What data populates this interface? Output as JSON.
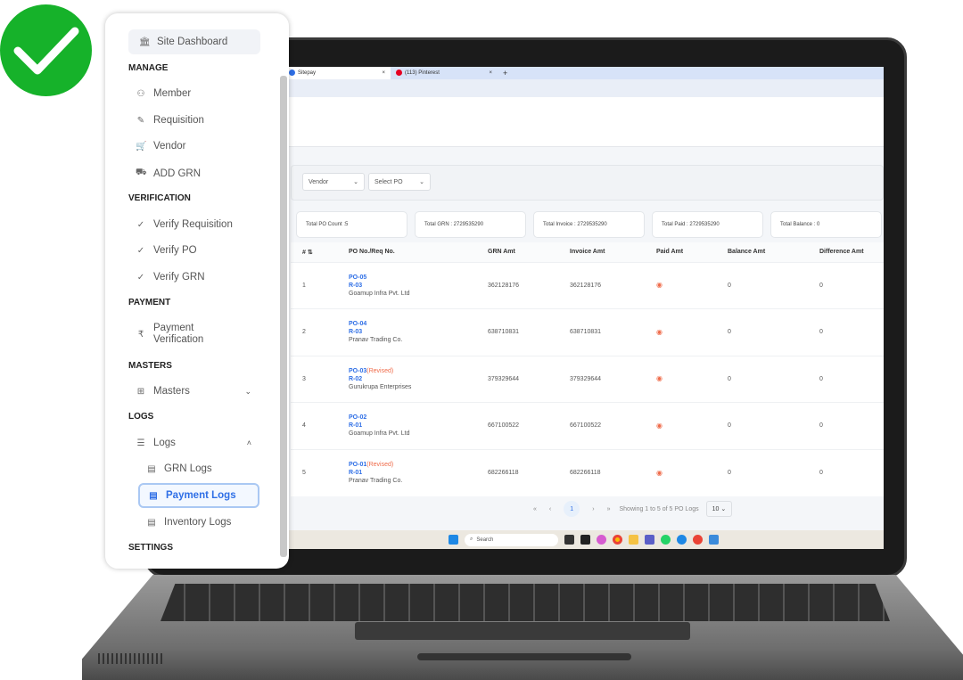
{
  "browser": {
    "tabs": [
      {
        "label": "Sitepay",
        "active": true
      },
      {
        "label": "(113) Pinterest",
        "active": false
      }
    ],
    "new_tab": "+",
    "close": "×"
  },
  "filters": {
    "vendor": "Vendor",
    "po": "Select PO"
  },
  "summary": [
    "Total PO Count :5",
    "Total GRN : 2729535290",
    "Total Invoice : 2729535290",
    "Total Paid : 2729535290",
    "Total Balance : 0"
  ],
  "table": {
    "headers": [
      "# ⇅",
      "PO No./Req No.",
      "GRN Amt",
      "Invoice Amt",
      "Paid Amt",
      "Balance Amt",
      "Difference Amt"
    ],
    "rows": [
      {
        "n": "1",
        "po": "PO-05",
        "rev": "",
        "req": "R-03",
        "vendor": "Goamup Infra Pvt. Ltd",
        "grn": "362128176",
        "inv": "362128176",
        "bal": "0",
        "diff": "0"
      },
      {
        "n": "2",
        "po": "PO-04",
        "rev": "",
        "req": "R-03",
        "vendor": "Pranav Trading Co.",
        "grn": "638710831",
        "inv": "638710831",
        "bal": "0",
        "diff": "0"
      },
      {
        "n": "3",
        "po": "PO-03",
        "rev": "(Revised)",
        "req": "R-02",
        "vendor": "Gurukrupa Enterprises",
        "grn": "379329644",
        "inv": "379329644",
        "bal": "0",
        "diff": "0"
      },
      {
        "n": "4",
        "po": "PO-02",
        "rev": "",
        "req": "R-01",
        "vendor": "Goamup Infra Pvt. Ltd",
        "grn": "667100522",
        "inv": "667100522",
        "bal": "0",
        "diff": "0"
      },
      {
        "n": "5",
        "po": "PO-01",
        "rev": "(Revised)",
        "req": "R-01",
        "vendor": "Pranav Trading Co.",
        "grn": "682266118",
        "inv": "682266118",
        "bal": "0",
        "diff": "0"
      }
    ]
  },
  "pager": {
    "first": "«",
    "prev": "‹",
    "page": "1",
    "next": "›",
    "last": "»",
    "showing": "Showing 1 to 5 of 5 PO Logs",
    "per_page": "10"
  },
  "taskbar": {
    "search": "Search"
  },
  "sidebar": {
    "dashboard": "Site Dashboard",
    "manage": "MANAGE",
    "member": "Member",
    "requisition": "Requisition",
    "vendor": "Vendor",
    "add_grn": "ADD GRN",
    "verification": "VERIFICATION",
    "verify_req": "Verify Requisition",
    "verify_po": "Verify PO",
    "verify_grn": "Verify GRN",
    "payment": "PAYMENT",
    "payment_verification_1": "Payment",
    "payment_verification_2": "Verification",
    "masters_h": "MASTERS",
    "masters": "Masters",
    "logs_h": "LOGS",
    "logs": "Logs",
    "grn_logs": "GRN Logs",
    "payment_logs": "Payment Logs",
    "inventory_logs": "Inventory Logs",
    "settings": "SETTINGS"
  },
  "colors": {
    "accent": "#2f6fe6",
    "revised": "#ef6b4a",
    "check": "#16b22a"
  }
}
